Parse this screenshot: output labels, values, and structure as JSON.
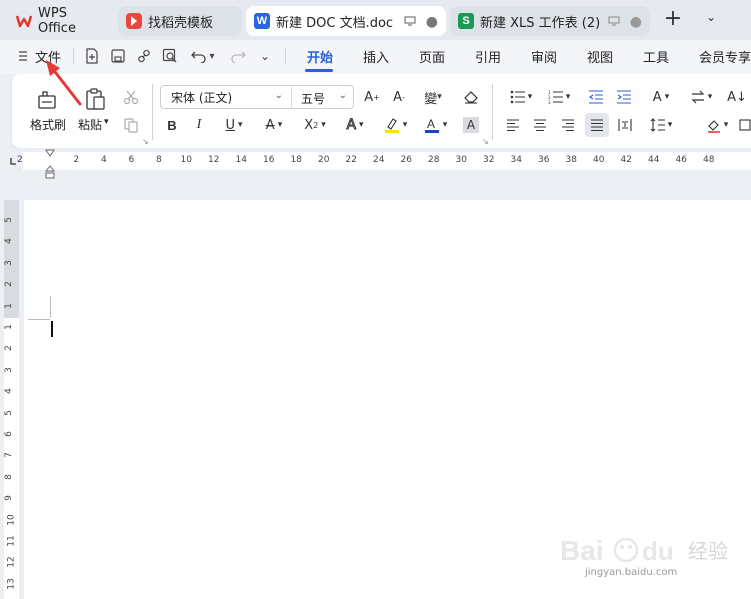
{
  "tabs": [
    {
      "label": "WPS Office",
      "icon": "wps-logo-icon"
    },
    {
      "label": "找稻壳模板",
      "icon": "docer-icon"
    },
    {
      "label": "新建 DOC 文档.doc",
      "icon": "word-doc-icon",
      "active": true
    },
    {
      "label": "新建 XLS 工作表 (2)",
      "icon": "xls-sheet-icon"
    }
  ],
  "menu": {
    "file_label": "文件",
    "items": [
      "开始",
      "插入",
      "页面",
      "引用",
      "审阅",
      "视图",
      "工具",
      "会员专享"
    ],
    "active": "开始"
  },
  "ribbon": {
    "format_painter_label": "格式刷",
    "paste_label": "粘贴",
    "font_name": "宋体 (正文)",
    "font_size": "五号"
  },
  "ruler": {
    "h_numbers": [
      "2",
      "2",
      "4",
      "6",
      "8",
      "10",
      "12",
      "14",
      "16",
      "18",
      "20",
      "22",
      "24",
      "26",
      "28",
      "30",
      "32",
      "34",
      "36",
      "38",
      "40",
      "42",
      "44",
      "46",
      "48"
    ],
    "v_numbers": [
      "5",
      "4",
      "3",
      "2",
      "1",
      "1",
      "2",
      "3",
      "4",
      "5",
      "6",
      "7",
      "8",
      "9",
      "10",
      "11",
      "12",
      "13"
    ]
  },
  "watermark": {
    "text": "Baidu 经验",
    "url_text": "jingyan.baidu.com"
  },
  "colors": {
    "accent": "#2b5fd9",
    "highlight": "#f5e60a",
    "font_color": "#1a3fd1",
    "annotation": "#e53935"
  }
}
